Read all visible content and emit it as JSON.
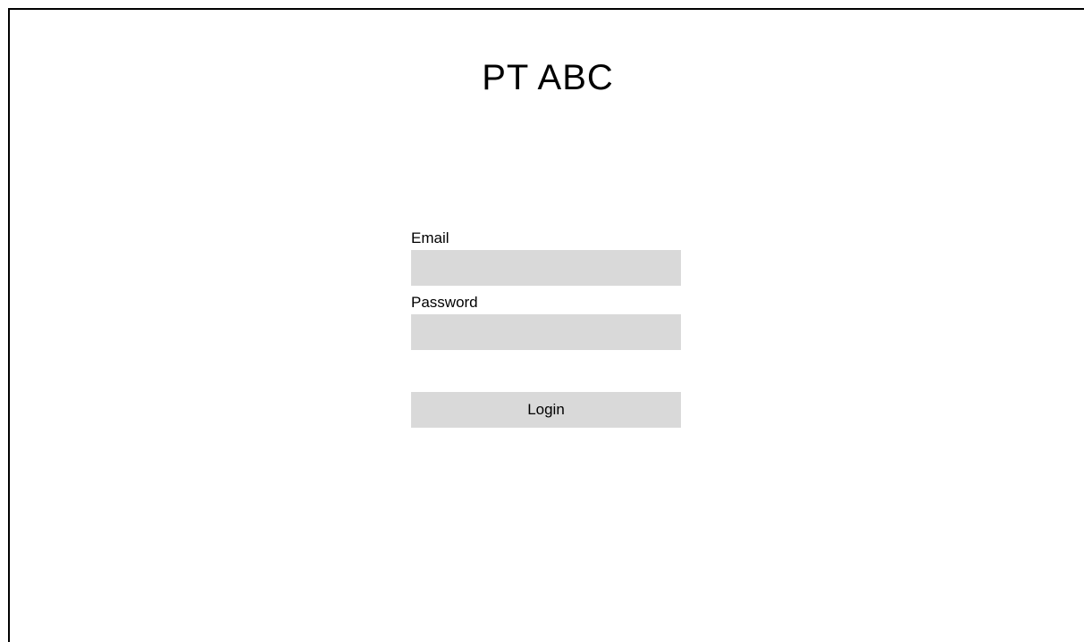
{
  "header": {
    "title": "PT ABC"
  },
  "login_form": {
    "email_label": "Email",
    "email_value": "",
    "email_placeholder": "",
    "password_label": "Password",
    "password_value": "",
    "password_placeholder": "",
    "login_button_label": "Login"
  },
  "colors": {
    "background": "#ffffff",
    "field_fill": "#d9d9d9",
    "border": "#000000",
    "text": "#000000"
  }
}
